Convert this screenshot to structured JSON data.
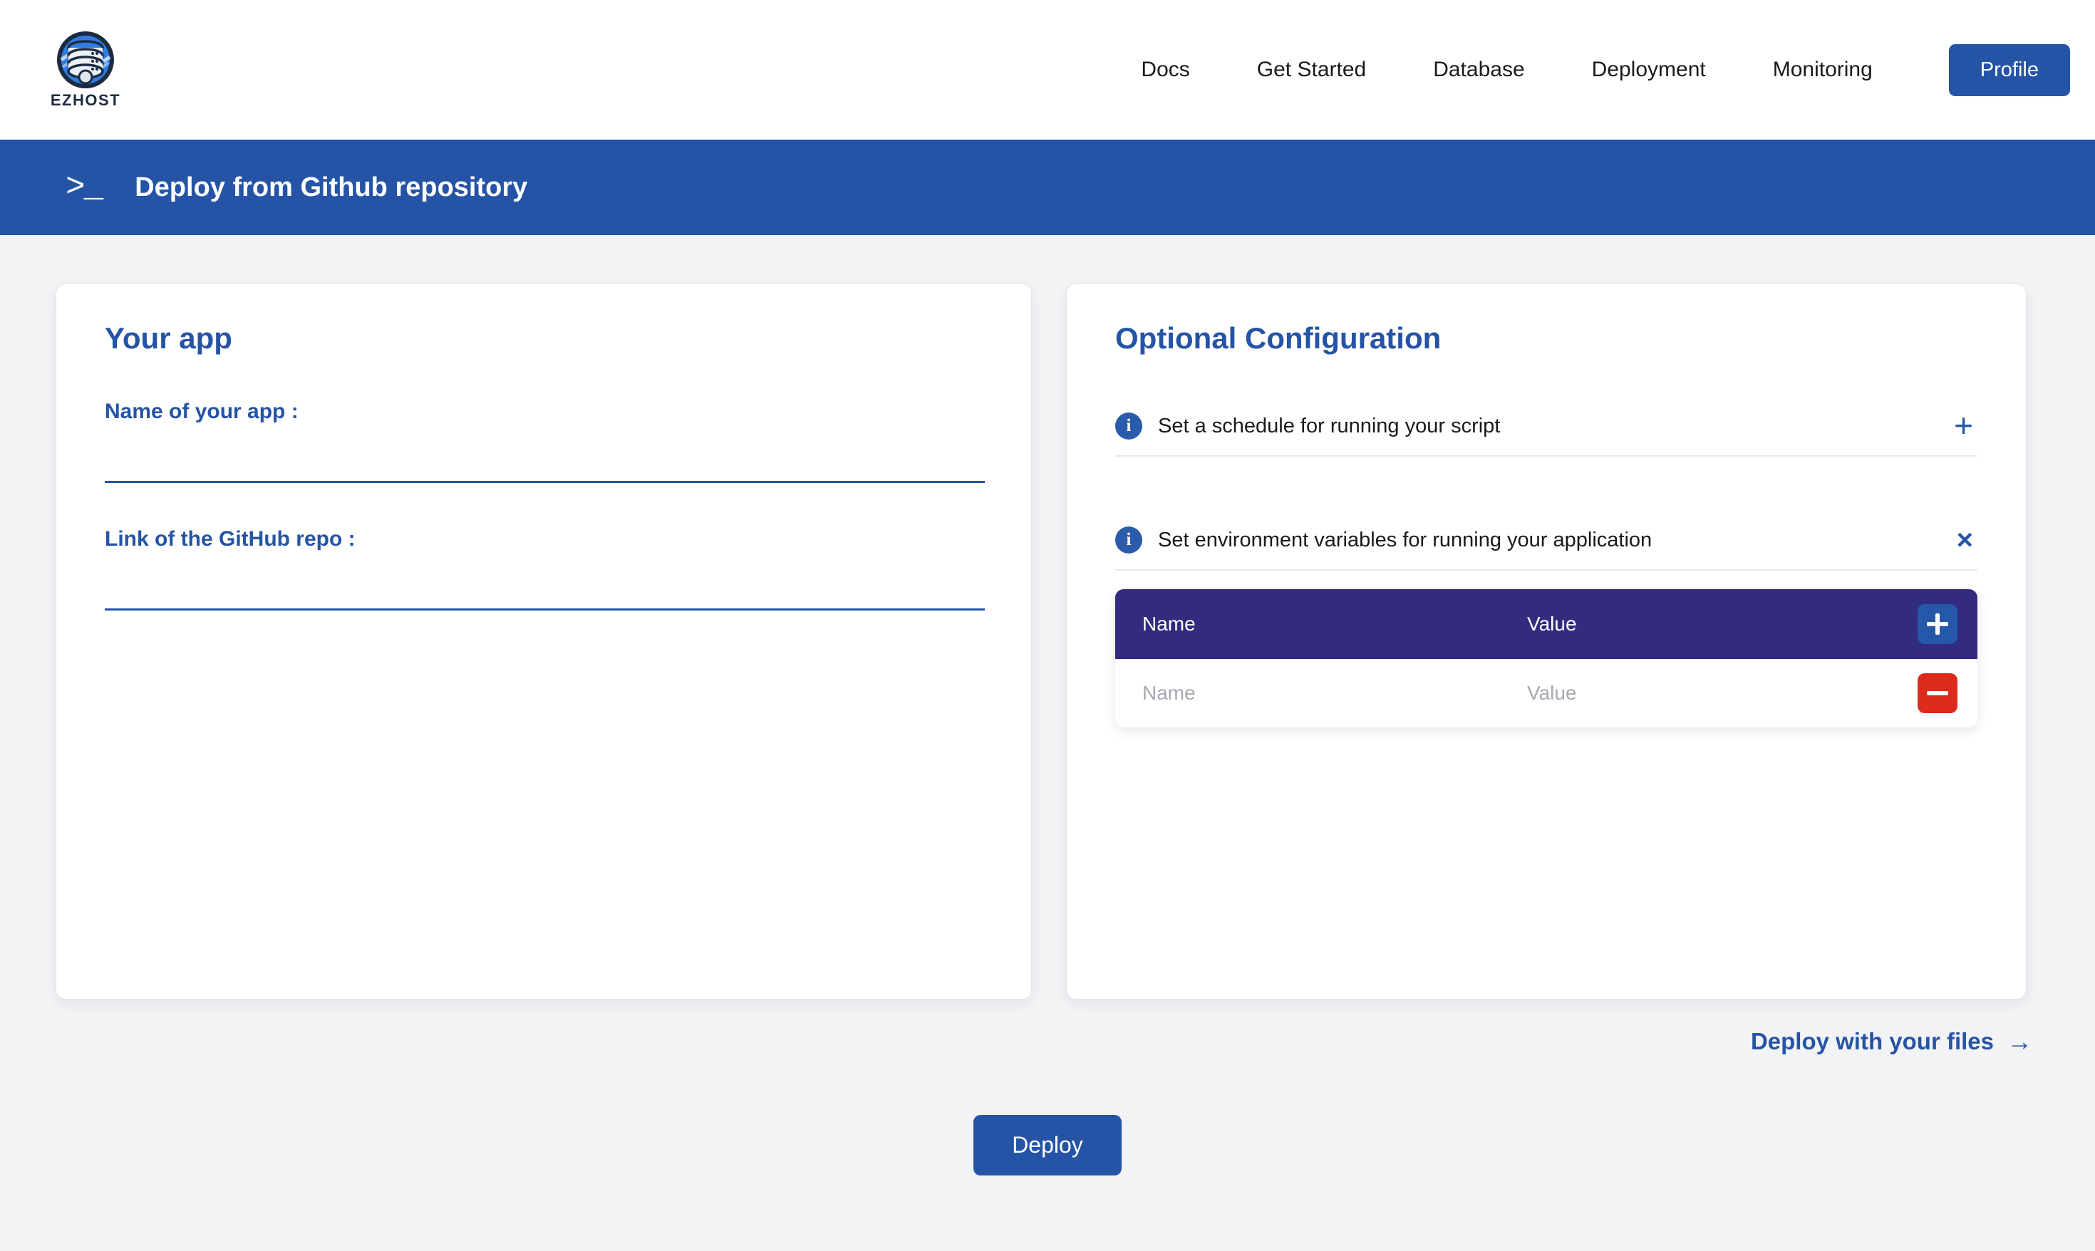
{
  "brand": {
    "name": "EZHOST",
    "logo_icon": "database-globe-logo"
  },
  "nav": {
    "links": [
      {
        "label": "Docs"
      },
      {
        "label": "Get Started"
      },
      {
        "label": "Database"
      },
      {
        "label": "Deployment"
      },
      {
        "label": "Monitoring"
      }
    ],
    "profile_label": "Profile"
  },
  "banner": {
    "prompt": ">_",
    "title": "Deploy from Github repository",
    "color": "#2554a6"
  },
  "your_app": {
    "title": "Your app",
    "fields": [
      {
        "label": "Name of your app :",
        "value": "",
        "placeholder": ""
      },
      {
        "label": "Link of the GitHub repo :",
        "value": "",
        "placeholder": ""
      }
    ]
  },
  "optional_config": {
    "title": "Optional Configuration",
    "options": [
      {
        "label": "Set a schedule for running your script",
        "toggle": "+",
        "expanded": false
      },
      {
        "label": "Set environment variables for running your application",
        "toggle": "×",
        "expanded": true
      }
    ],
    "env_table": {
      "columns": [
        "Name",
        "Value"
      ],
      "add_label": "+",
      "remove_label": "−",
      "header_color": "#332b80",
      "add_color": "#2558a8",
      "remove_color": "#dd2b1c",
      "rows": [
        {
          "name": "",
          "name_placeholder": "Name",
          "value": "",
          "value_placeholder": "Value"
        }
      ]
    }
  },
  "footer": {
    "files_link_label": "Deploy with your files",
    "files_link_arrow": "→",
    "deploy_label": "Deploy"
  }
}
